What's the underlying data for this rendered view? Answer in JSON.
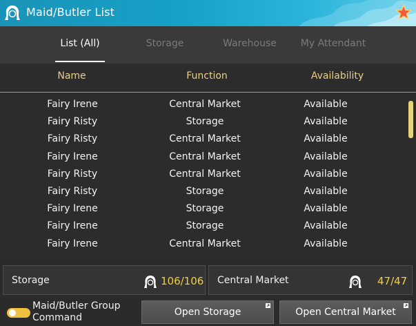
{
  "window": {
    "title": "Maid/Butler List",
    "accent": "#1a93b8"
  },
  "tabs": [
    {
      "label": "List (All)",
      "active": true
    },
    {
      "label": "Storage",
      "active": false
    },
    {
      "label": "Warehouse",
      "active": false
    },
    {
      "label": "My Attendant",
      "active": false
    }
  ],
  "table": {
    "columns": [
      "Name",
      "Function",
      "Availability"
    ],
    "rows": [
      {
        "name": "Fairy Irene",
        "function": "Central Market",
        "availability": "Available"
      },
      {
        "name": "Fairy Risty",
        "function": "Storage",
        "availability": "Available"
      },
      {
        "name": "Fairy Risty",
        "function": "Central Market",
        "availability": "Available"
      },
      {
        "name": "Fairy Irene",
        "function": "Central Market",
        "availability": "Available"
      },
      {
        "name": "Fairy Risty",
        "function": "Central Market",
        "availability": "Available"
      },
      {
        "name": "Fairy Risty",
        "function": "Storage",
        "availability": "Available"
      },
      {
        "name": "Fairy Irene",
        "function": "Storage",
        "availability": "Available"
      },
      {
        "name": "Fairy Irene",
        "function": "Storage",
        "availability": "Available"
      },
      {
        "name": "Fairy Irene",
        "function": "Central Market",
        "availability": "Available"
      }
    ]
  },
  "stats": {
    "storage": {
      "label": "Storage",
      "value": "106/106",
      "icon": "maid-icon"
    },
    "market": {
      "label": "Central Market",
      "value": "47/47",
      "icon": "maid-icon"
    }
  },
  "footer": {
    "group_command_label": "Maid/Butler Group Command",
    "group_command_enabled": true,
    "open_storage_label": "Open Storage",
    "open_market_label": "Open Central Market"
  }
}
